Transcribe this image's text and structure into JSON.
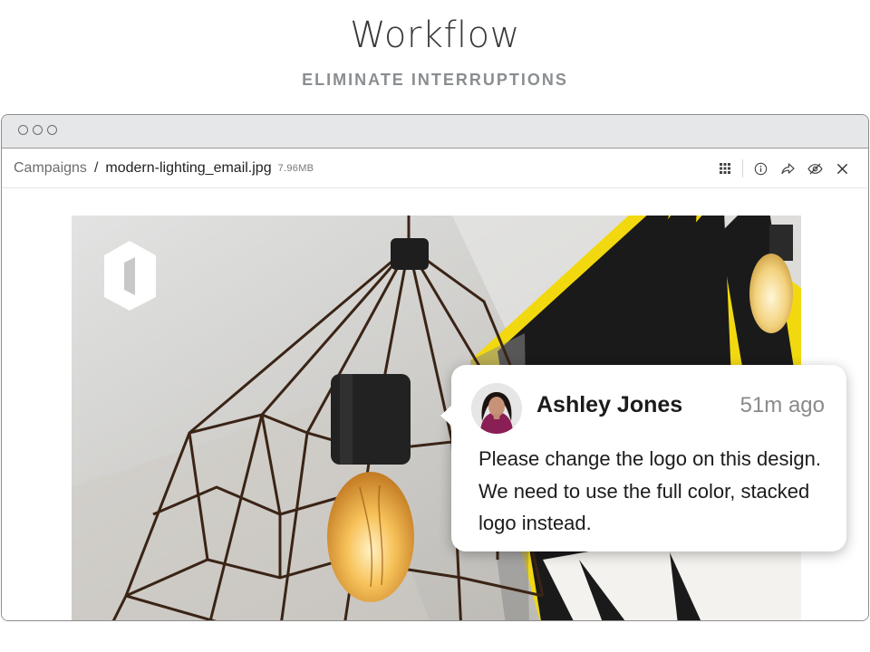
{
  "header": {
    "title": "Workflow",
    "subtitle": "ELIMINATE INTERRUPTIONS"
  },
  "window": {
    "traffic_lights": [
      "close-dot",
      "minimize-dot",
      "zoom-dot"
    ]
  },
  "breadcrumb": {
    "root": "Campaigns",
    "separator": "/",
    "file_name": "modern-lighting_email.jpg",
    "file_size": "7.96MB"
  },
  "toolbar": {
    "icons": [
      "grid-icon",
      "info-icon",
      "share-icon",
      "hide-icon",
      "close-icon"
    ]
  },
  "comment": {
    "author": "Ashley Jones",
    "time": "51m ago",
    "text": "Please change the logo on this design. We need to use the full color, stacked logo instead."
  },
  "colors": {
    "lamp_yellow": "#f2d90f",
    "lamp_black": "#1a1a1a",
    "wire_copper": "#3a2416",
    "bulb_glow": "#f7c25a"
  }
}
